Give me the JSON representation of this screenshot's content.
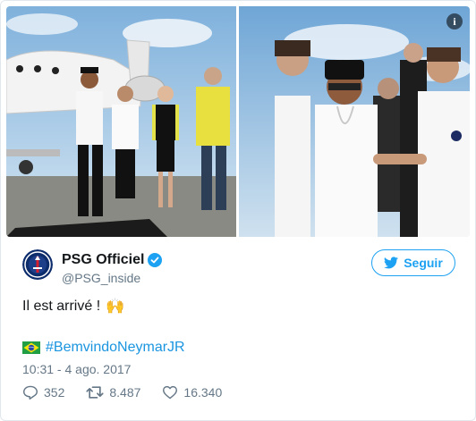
{
  "media": {
    "info_icon_glyph": "i"
  },
  "account": {
    "display_name": "PSG Officiel",
    "handle": "@PSG_inside",
    "verified_icon": "verified-badge-icon",
    "avatar_icon": "psg-crest-icon"
  },
  "follow_button": {
    "label": "Seguir",
    "icon": "twitter-bird-icon"
  },
  "tweet": {
    "text": "Il est arrivé !",
    "emoji": "🙌",
    "flag_icon": "brazil-flag-icon",
    "hashtag": "#BemvindoNeymarJR",
    "timestamp": "10:31 - 4 ago. 2017"
  },
  "actions": {
    "replies": "352",
    "retweets": "8.487",
    "likes": "16.340"
  },
  "colors": {
    "accent": "#1da1f2",
    "hashtag": "#1b95e0",
    "text_primary": "#14171a",
    "text_secondary": "#657786",
    "border": "#e1e8ed"
  }
}
